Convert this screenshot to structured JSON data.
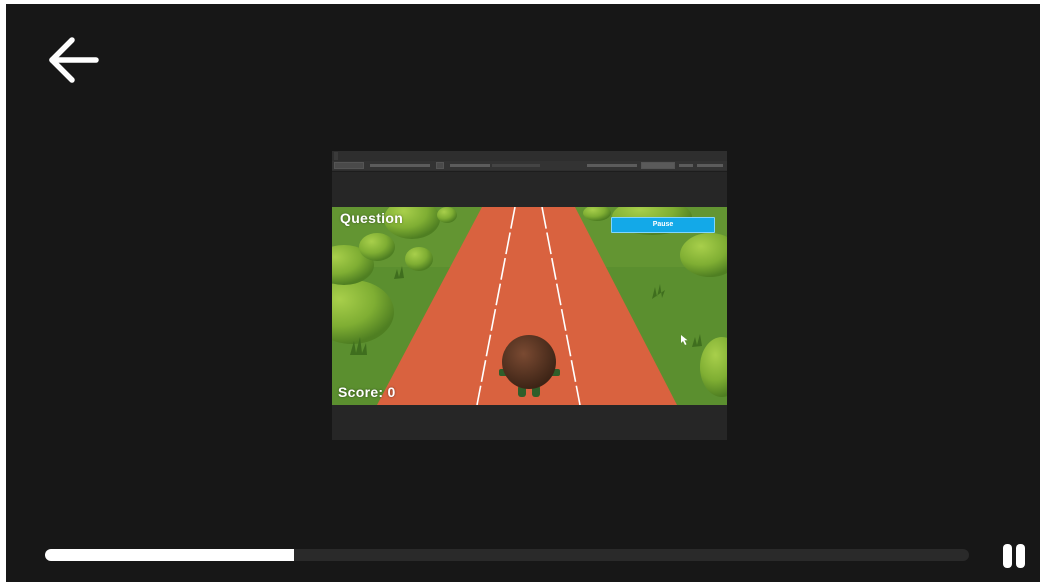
{
  "player": {
    "background_color": "#171717",
    "back_icon": "arrow-left-icon",
    "pause_icon": "pause-icon",
    "progress": {
      "played_fraction": 0.27,
      "fill_color": "#ffffff",
      "track_color": "#2a2a2a"
    }
  },
  "video": {
    "game": {
      "question_label": "Question",
      "score_label": "Score: 0",
      "pause_button_label": "Pause",
      "track_color": "#d9623f",
      "grass_color": "#5b8f2f",
      "button_color": "#13a9e8"
    }
  }
}
